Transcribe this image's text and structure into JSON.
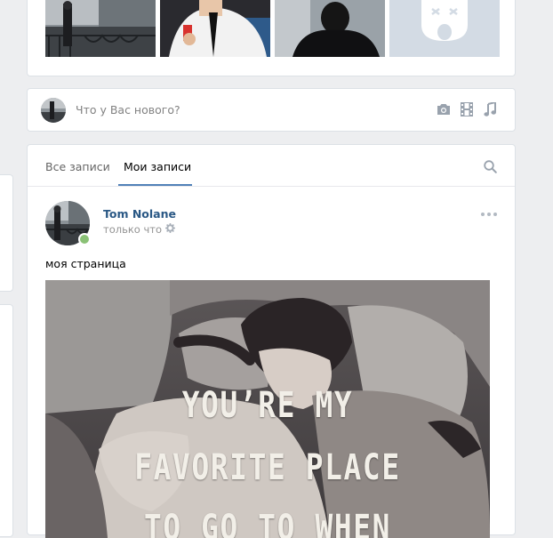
{
  "compose": {
    "placeholder": "Что у Вас нового?"
  },
  "tools": {
    "photo_icon": "camera-icon",
    "video_icon": "film-icon",
    "audio_icon": "music-note-icon"
  },
  "wall": {
    "tabs": [
      {
        "label": "Все записи"
      },
      {
        "label": "Мои записи"
      }
    ],
    "active_tab": 1
  },
  "post": {
    "author": "Tom Nolane",
    "time": "только что",
    "text": "моя страница",
    "image_caption": [
      "YOU’RE MY",
      "FAVORITE PLACE",
      "TO GO TO WHEN"
    ]
  },
  "colors": {
    "background": "#edeef0",
    "link": "#2a5885",
    "accent": "#5181b8",
    "online": "#8ac176"
  }
}
